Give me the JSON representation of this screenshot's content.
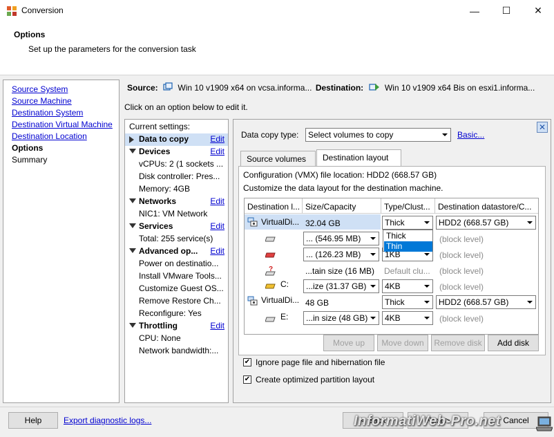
{
  "window": {
    "title": "Conversion",
    "minimize": "—",
    "maximize": "☐",
    "close": "✕"
  },
  "header": {
    "title": "Options",
    "subtitle": "Set up the parameters for the conversion task"
  },
  "nav": {
    "items": [
      {
        "label": "Source System",
        "state": "link"
      },
      {
        "label": "Source Machine",
        "state": "link"
      },
      {
        "label": "Destination System",
        "state": "link"
      },
      {
        "label": "Destination Virtual Machine",
        "state": "link"
      },
      {
        "label": "Destination Location",
        "state": "link"
      },
      {
        "label": "Options",
        "state": "current"
      },
      {
        "label": "Summary",
        "state": "plain"
      }
    ]
  },
  "source_bar": {
    "source_label": "Source:",
    "source_value": "Win 10 v1909 x64 on vcsa.informa...",
    "destination_label": "Destination:",
    "destination_value": "Win 10 v1909 x64 Bis on esxi1.informa..."
  },
  "hint": "Click on an option below to edit it.",
  "settings": {
    "current_label": "Current settings:",
    "edit_label": "Edit",
    "sections": [
      {
        "title": "Data to copy",
        "items": [],
        "selected": true
      },
      {
        "title": "Devices",
        "items": [
          "vCPUs: 2 (1 sockets ...",
          "Disk controller: Pres...",
          "Memory: 4GB"
        ]
      },
      {
        "title": "Networks",
        "items": [
          "NIC1: VM Network"
        ]
      },
      {
        "title": "Services",
        "items": [
          "Total: 255 service(s)"
        ]
      },
      {
        "title": "Advanced op...",
        "items": [
          "Power on destinatio...",
          "Install VMware Tools...",
          "Customize Guest OS...",
          "Remove Restore Ch...",
          "Reconfigure: Yes"
        ]
      },
      {
        "title": "Throttling",
        "items": [
          "CPU: None",
          "Network bandwidth:..."
        ]
      }
    ]
  },
  "data_copy": {
    "type_label": "Data copy type:",
    "type_value": "Select volumes to copy",
    "basic_link": "Basic..."
  },
  "tabs": [
    {
      "label": "Source volumes",
      "active": false
    },
    {
      "label": "Destination layout",
      "active": true
    }
  ],
  "layout": {
    "config_location": "Configuration (VMX) file location: HDD2 (668.57 GB)",
    "customize_text": "Customize the data layout for the destination machine.",
    "columns": [
      "Destination l...",
      "Size/Capacity",
      "Type/Clust...",
      "Destination datastore/C..."
    ],
    "rows": [
      {
        "name": "VirtualDi...",
        "size": "32.04 GB",
        "type": "Thick",
        "datastore": "HDD2 (668.57 GB)",
        "icon": "virtual-disk-icon"
      },
      {
        "name": "",
        "size": "... (546.95 MB)",
        "type": "",
        "datastore": "(block level)",
        "icon": "partition-icon"
      },
      {
        "name": "",
        "size": "... (126.23 MB)",
        "type": "1KB",
        "datastore": "(block level)",
        "icon": "system-partition-icon"
      },
      {
        "name": "",
        "size": "...tain size (16 MB)",
        "type": "Default clu...",
        "datastore": "(block level)",
        "icon": "unknown-partition-icon"
      },
      {
        "name": "C:",
        "size": "...ize (31.37 GB)",
        "type": "4KB",
        "datastore": "(block level)",
        "icon": "volume-c-icon"
      },
      {
        "name": "VirtualDi...",
        "size": "48 GB",
        "type": "Thick",
        "datastore": "HDD2 (668.57 GB)",
        "icon": "virtual-disk-icon"
      },
      {
        "name": "E:",
        "size": "...in size (48 GB)",
        "type": "4KB",
        "datastore": "(block level)",
        "icon": "partition-icon"
      }
    ],
    "dropdown_options": [
      "Thick",
      "Thin"
    ],
    "dropdown_highlight": "Thin"
  },
  "grid_buttons": {
    "move_up": "Move up",
    "move_down": "Move down",
    "remove_disk": "Remove disk",
    "add_disk": "Add disk"
  },
  "options": {
    "ignore_pagefile": "Ignore page file and hibernation file",
    "optimized_layout": "Create optimized partition layout"
  },
  "footer": {
    "help": "Help",
    "export_logs": "Export diagnostic logs...",
    "back": "< Back",
    "next": "Next >",
    "cancel": "Cancel"
  },
  "watermark": "InformatiWeb-Pro.net",
  "colors": {
    "link": "#0000d0",
    "selection": "#cfe0f5",
    "highlight": "#0078d7"
  }
}
